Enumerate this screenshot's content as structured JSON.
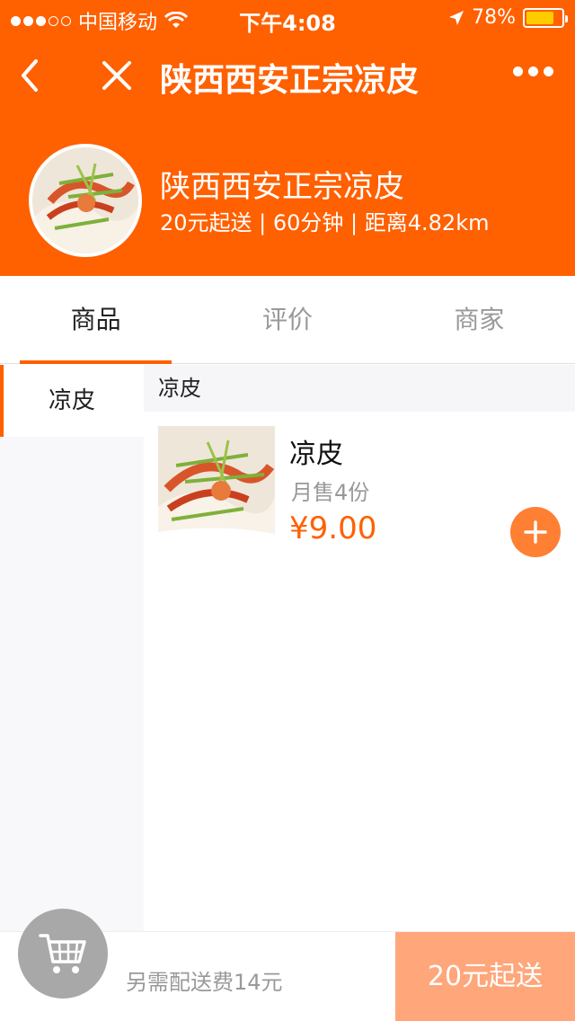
{
  "status_bar": {
    "carrier": "中国移动",
    "time": "下午4:08",
    "battery_percent": "78%",
    "battery_level": 0.78,
    "signal_bars": 5,
    "signal_filled": 3
  },
  "nav": {
    "title": "陕西西安正宗凉皮",
    "back_icon": "chevron-left-icon",
    "close_icon": "close-icon",
    "more_icon": "more-dots-icon"
  },
  "shop": {
    "name": "陕西西安正宗凉皮",
    "meta": "20元起送 | 60分钟 | 距离4.82km"
  },
  "tabs": [
    {
      "label": "商品",
      "active": true
    },
    {
      "label": "评价",
      "active": false
    },
    {
      "label": "商家",
      "active": false
    }
  ],
  "categories": [
    {
      "label": "凉皮",
      "active": true
    }
  ],
  "section": {
    "title": "凉皮"
  },
  "products": [
    {
      "name": "凉皮",
      "sales": "月售4份",
      "price": "¥9.00"
    }
  ],
  "bottom": {
    "delivery_fee": "另需配送费14元",
    "min_order": "20元起送",
    "cart_icon": "cart-icon"
  },
  "colors": {
    "accent": "#ff6000",
    "add_button": "#ff7f33",
    "min_order_bg": "#ffa67a",
    "cart_bg": "#a8a8a8"
  }
}
